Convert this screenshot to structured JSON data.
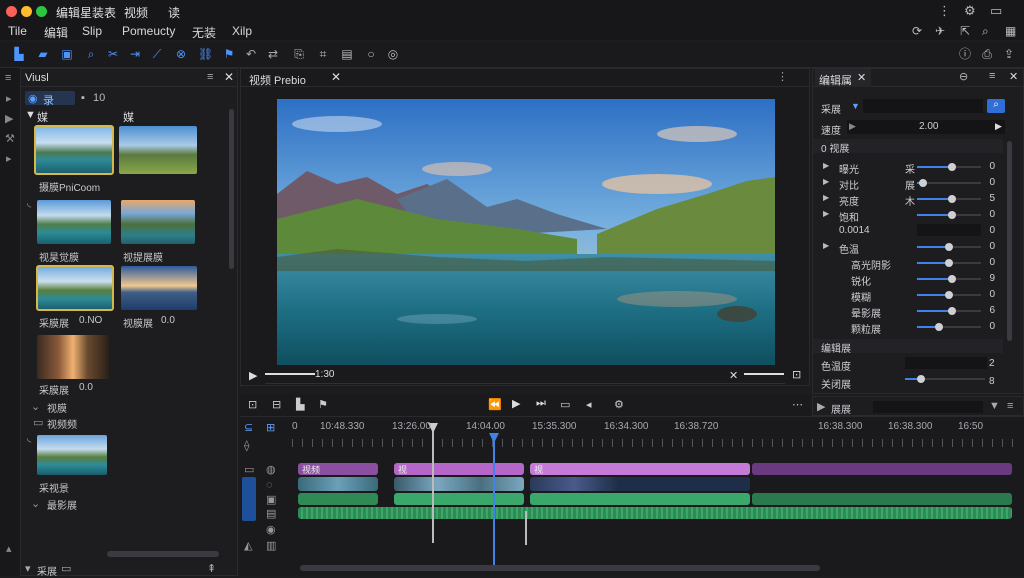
{
  "app": {
    "title": "编辑星装表",
    "title_tab_1": "视频",
    "title_tab_2": "读"
  },
  "menu": [
    "Tile",
    "编辑",
    "Slip",
    "Pomeucty",
    "无装",
    "Xilp"
  ],
  "left_panel": {
    "tab_label": "Viusl",
    "bin_tab_1": "录",
    "bin_tab_2": "10",
    "section_1": "媒",
    "section_2": "媒",
    "items": [
      {
        "label": "摄膜PniCoom"
      },
      {
        "label": "视昊觉膜"
      },
      {
        "label": "视提展膜"
      },
      {
        "label": "采膜展",
        "value": "0.NO"
      },
      {
        "label": "视膜展",
        "value": "0.0"
      },
      {
        "label": "采膜展",
        "value": "0.0"
      },
      {
        "label": "采视景"
      }
    ],
    "folders": [
      "视膜",
      "视频频"
    ],
    "folder_3": "最影展",
    "footer_label": "采展"
  },
  "preview": {
    "tab_label": "视频 Prebio",
    "scrub_time": "1:30"
  },
  "inspector": {
    "tab_label": "编辑属",
    "search_label": "采展",
    "speed_label": "速度",
    "speed_value": "2.00",
    "group_label": "0 视展",
    "rows": [
      {
        "name": "曝光",
        "tag": "采",
        "value": "0",
        "level": 0.55
      },
      {
        "name": "对比",
        "tag": "展",
        "value": "0",
        "level": 0.1
      },
      {
        "name": "亮度",
        "tag": "木",
        "value": "5",
        "level": 0.55
      },
      {
        "name": "饱和",
        "tag": "",
        "value": "0",
        "level": 0.55
      },
      {
        "name": "0.0014",
        "tag": "",
        "value": "0",
        "level": null
      },
      {
        "name": "色温",
        "tag": "",
        "value": "0",
        "level": 0.5
      },
      {
        "name": "高光阴影",
        "tag": "",
        "value": "0",
        "level": 0.5
      },
      {
        "name": "锐化",
        "tag": "",
        "value": "9",
        "level": 0.55
      },
      {
        "name": "模糊",
        "tag": "",
        "value": "0",
        "level": 0.5
      },
      {
        "name": "晕影展",
        "tag": "",
        "value": "6",
        "level": 0.55
      },
      {
        "name": "颗粒展",
        "tag": "",
        "value": "0",
        "level": 0.35
      }
    ],
    "section_2": "编辑展",
    "row_b1": {
      "name": "色温度",
      "value": "2"
    },
    "row_b2": {
      "name": "关闭展",
      "value": "8",
      "level": 0.2
    },
    "effects_label": "展展"
  },
  "timeline": {
    "timecodes": [
      "10:48.330",
      "13:26.00",
      "14:04.00",
      "15:35.300",
      "16:34.300",
      "16:38.720",
      "16:38.300",
      "16:38.300",
      "16:50"
    ],
    "clip_1": "视频",
    "clip_2": "视",
    "clip_3": "视"
  },
  "colors": {
    "accent": "#3f82e8",
    "clip_purple": "#b467c8",
    "clip_green": "#3aa86b",
    "selection": "#d4b84a"
  }
}
